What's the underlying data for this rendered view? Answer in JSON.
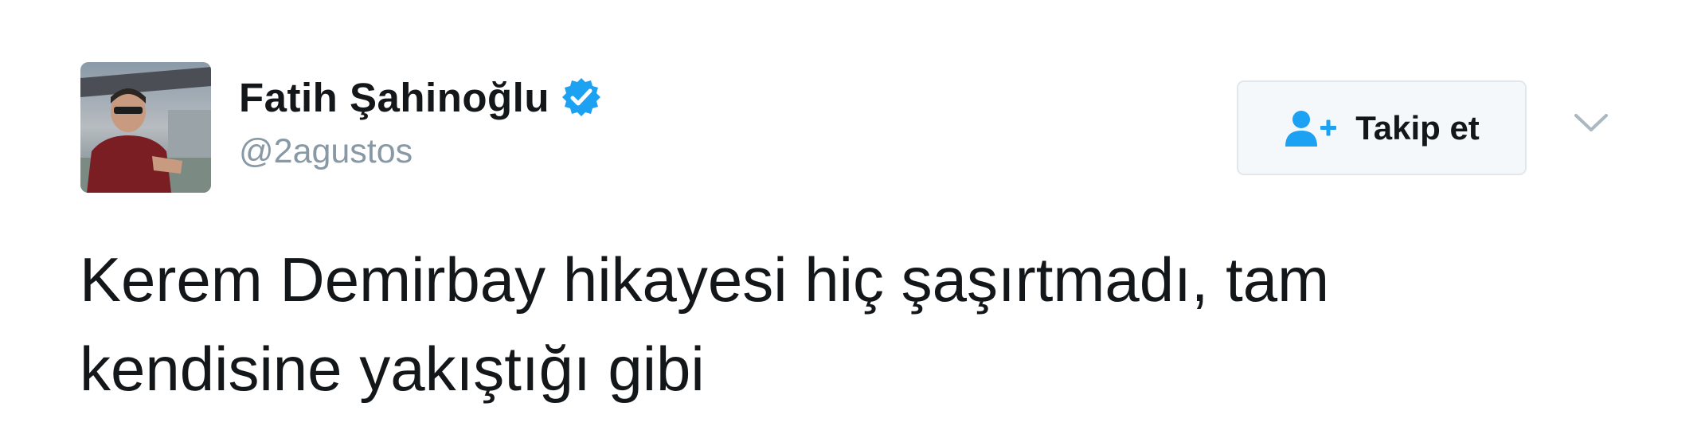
{
  "author": {
    "display_name": "Fatih Şahinoğlu",
    "handle": "@2agustos",
    "verified": true
  },
  "follow_button": {
    "label": "Takip et",
    "icon": "add-user-icon"
  },
  "menu": {
    "icon": "chevron-down-icon"
  },
  "tweet": {
    "text_line_1": "Kerem Demirbay hikayesi hiç şaşırtmadı, tam",
    "text_line_2": "kendisine yakıştığı gibi"
  },
  "colors": {
    "verified_badge": "#1da1f2",
    "follow_icon": "#1da1f2",
    "handle": "#8899a6",
    "text": "#14171a",
    "button_bg": "#f5f8fa",
    "button_border": "#e1e8ed"
  }
}
